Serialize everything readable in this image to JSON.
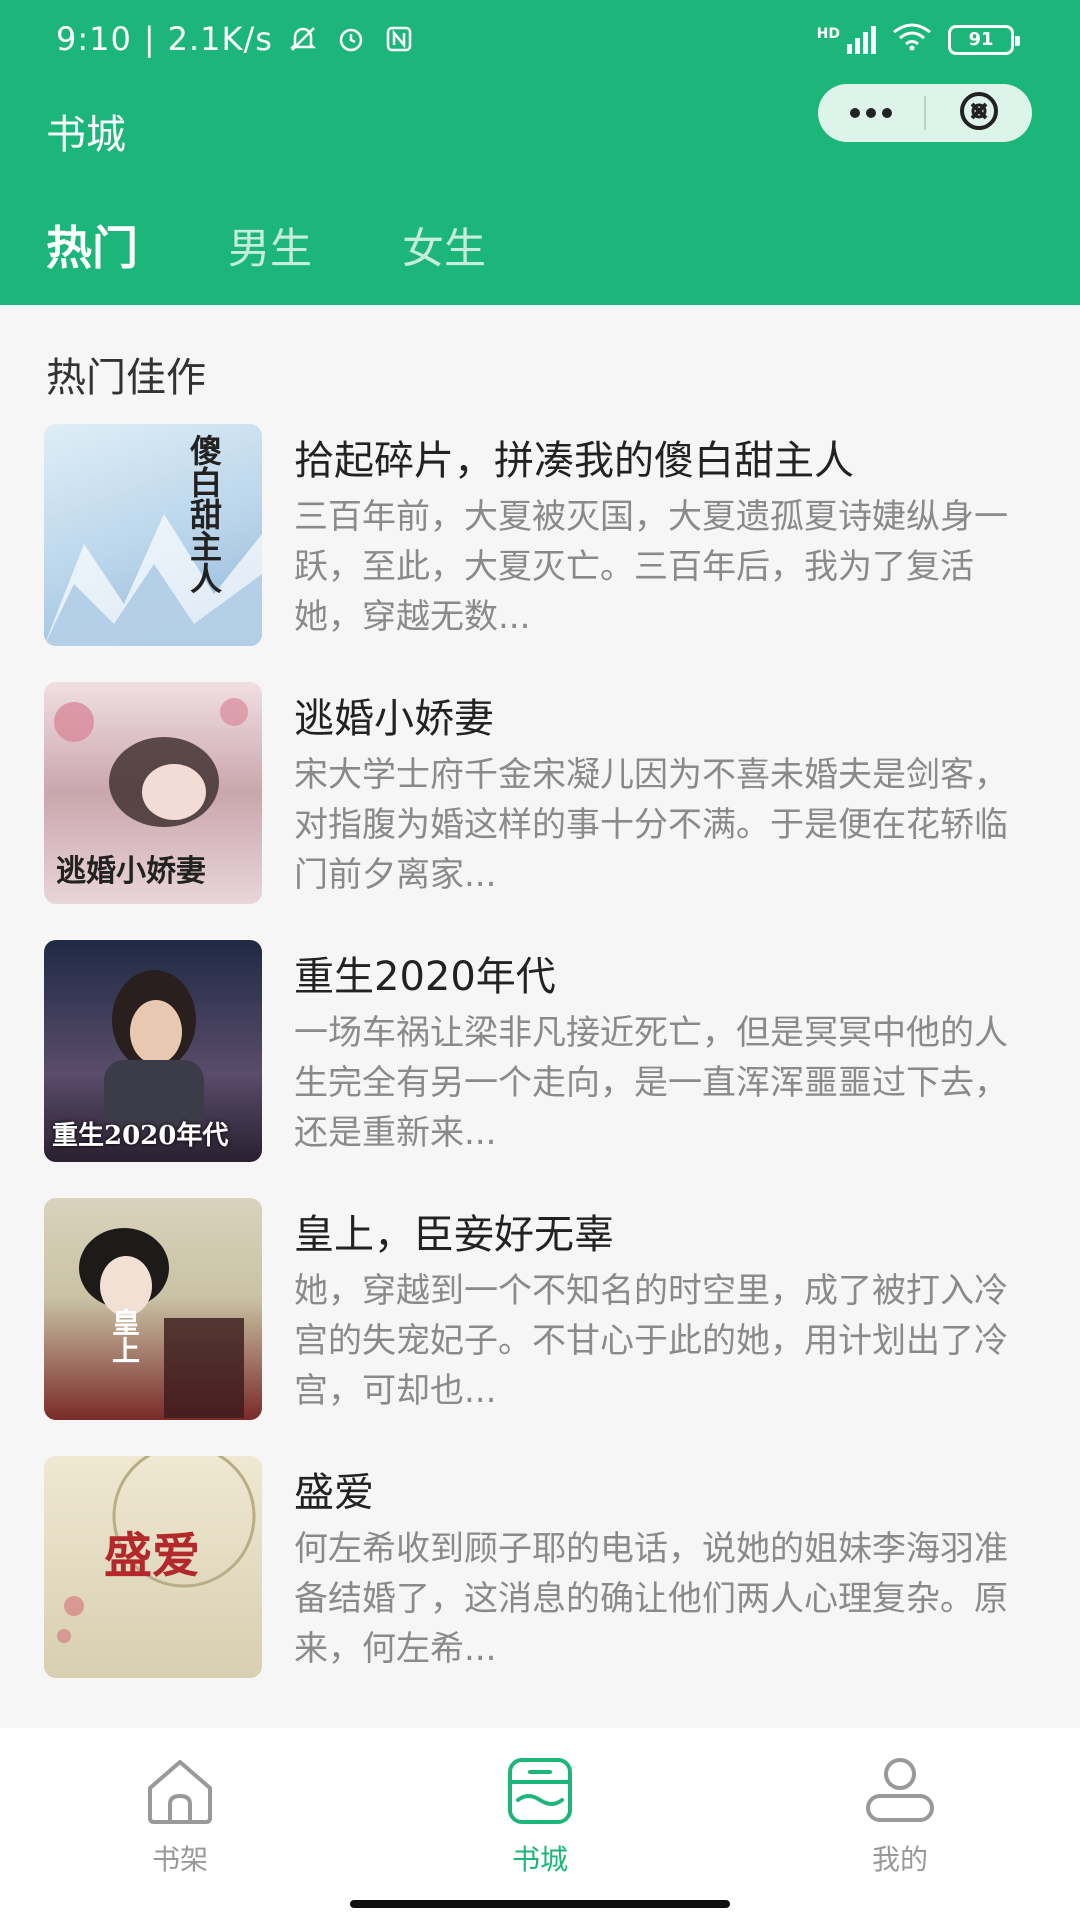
{
  "status_bar": {
    "time": "9:10",
    "net_speed": "2.1K/s",
    "network": "HD",
    "battery": "91"
  },
  "header": {
    "title": "书城"
  },
  "tabs": [
    {
      "label": "热门",
      "active": true
    },
    {
      "label": "男生",
      "active": false
    },
    {
      "label": "女生",
      "active": false
    }
  ],
  "section": {
    "title": "热门佳作"
  },
  "books": [
    {
      "title": "拾起碎片，拼凑我的傻白甜主人",
      "desc": "三百年前，大夏被灭国，大夏遗孤夏诗婕纵身一跃，至此，大夏灭亡。三百年后，我为了复活她，穿越无数...",
      "cover_text": "傻白甜主人",
      "cover_colors": [
        "#b9d4ea",
        "#dfeef7"
      ]
    },
    {
      "title": "逃婚小娇妻",
      "desc": "宋大学士府千金宋凝儿因为不喜未婚夫是剑客，对指腹为婚这样的事十分不满。于是便在花轿临门前夕离家...",
      "cover_text": "逃婚小娇妻",
      "cover_colors": [
        "#caa6ad",
        "#f0dfe2"
      ]
    },
    {
      "title": "重生2020年代",
      "desc": "一场车祸让梁非凡接近死亡，但是冥冥中他的人生完全有另一个走向，是一直浑浑噩噩过下去，还是重新来...",
      "cover_text": "重生2020年代",
      "cover_colors": [
        "#1f2a44",
        "#5a4c6b"
      ]
    },
    {
      "title": "皇上，臣妾好无辜",
      "desc": "她，穿越到一个不知名的时空里，成了被打入冷宫的失宠妃子。不甘心于此的她，用计划出了冷宫，可却也...",
      "cover_text": "皇上",
      "cover_colors": [
        "#c9c2a4",
        "#7a2a2a"
      ]
    },
    {
      "title": "盛爱",
      "desc": "何左希收到顾子耶的电话，说她的姐妹李海羽准备结婚了，这消息的确让他们两人心理复杂。原来，何左希...",
      "cover_text": "盛爱",
      "cover_colors": [
        "#efe8d2",
        "#d8cfb1"
      ]
    }
  ],
  "bottom_nav": [
    {
      "label": "书架",
      "icon": "bookshelf-icon",
      "active": false
    },
    {
      "label": "书城",
      "icon": "bookstore-icon",
      "active": true
    },
    {
      "label": "我的",
      "icon": "profile-icon",
      "active": false
    }
  ],
  "colors": {
    "accent": "#1cb67a",
    "muted_text": "#8a8a8a"
  }
}
